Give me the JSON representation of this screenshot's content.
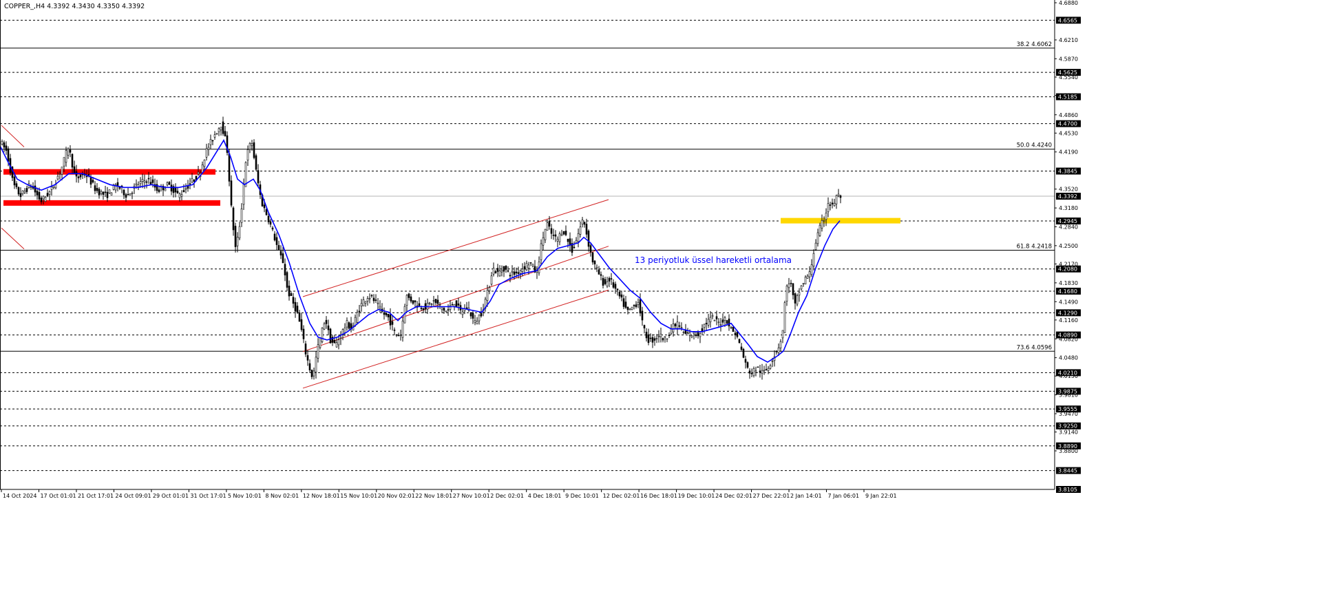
{
  "header": {
    "symbol": "COPPER_,H4",
    "ohlc": "4.3392 4.3430 4.3350 4.3392"
  },
  "annotation": {
    "ema_label": "13 periyotluk üssel hareketli ortalama"
  },
  "chart_data": {
    "type": "candlestick",
    "symbol": "COPPER_",
    "timeframe": "H4",
    "ylim": [
      3.8105,
      4.688
    ],
    "price_ticks": [
      "4.6880",
      "4.6210",
      "4.5870",
      "4.5540",
      "4.5210",
      "4.4860",
      "4.4530",
      "4.4190",
      "4.3520",
      "4.3180",
      "4.2840",
      "4.2500",
      "4.2170",
      "4.1830",
      "4.1490",
      "4.1160",
      "4.0820",
      "4.0480",
      "4.0150",
      "3.9810",
      "3.9470",
      "3.9140",
      "3.8800"
    ],
    "horizontal_levels": [
      4.6565,
      4.5625,
      4.5185,
      4.47,
      4.3845,
      4.2945,
      4.208,
      4.168,
      4.129,
      4.089,
      4.021,
      3.9875,
      3.9555,
      3.925,
      3.889,
      3.8445
    ],
    "level_labels": [
      "4.6565",
      "4.5625",
      "4.5185",
      "4.4700",
      "4.3845",
      "4.2945",
      "4.2080",
      "4.1680",
      "4.1290",
      "4.0890",
      "4.0210",
      "3.9875",
      "3.9555",
      "3.9250",
      "3.8890",
      "3.8445",
      "3.8105"
    ],
    "current_price": {
      "value": 4.3392,
      "label": "4.3392"
    },
    "fibonacci": [
      {
        "label": "38.2 4.6062",
        "value": 4.6062
      },
      {
        "label": "50.0 4.4240",
        "value": 4.424
      },
      {
        "label": "61.8 4.2418",
        "value": 4.2418
      },
      {
        "label": "73.6 4.0596",
        "value": 4.0596
      }
    ],
    "time_labels": [
      "14 Oct 2024",
      "17 Oct 01:01",
      "21 Oct 17:01",
      "24 Oct 09:01",
      "29 Oct 01:01",
      "31 Oct 17:01",
      "5 Nov 10:01",
      "8 Nov 02:01",
      "12 Nov 18:01",
      "15 Nov 10:01",
      "20 Nov 02:01",
      "22 Nov 18:01",
      "27 Nov 10:01",
      "2 Dec 02:01",
      "4 Dec 18:01",
      "9 Dec 10:01",
      "12 Dec 02:01",
      "16 Dec 18:01",
      "19 Dec 10:01",
      "24 Dec 02:01",
      "27 Dec 22:01",
      "2 Jan 14:01",
      "7 Jan 06:01",
      "9 Jan 22:01"
    ],
    "price_path": [
      [
        0,
        4.44
      ],
      [
        10,
        4.42
      ],
      [
        20,
        4.36
      ],
      [
        30,
        4.34
      ],
      [
        45,
        4.36
      ],
      [
        60,
        4.33
      ],
      [
        75,
        4.35
      ],
      [
        90,
        4.39
      ],
      [
        100,
        4.43
      ],
      [
        110,
        4.37
      ],
      [
        125,
        4.38
      ],
      [
        140,
        4.35
      ],
      [
        155,
        4.34
      ],
      [
        170,
        4.36
      ],
      [
        185,
        4.34
      ],
      [
        200,
        4.36
      ],
      [
        215,
        4.37
      ],
      [
        230,
        4.35
      ],
      [
        245,
        4.36
      ],
      [
        260,
        4.34
      ],
      [
        275,
        4.36
      ],
      [
        290,
        4.38
      ],
      [
        300,
        4.42
      ],
      [
        312,
        4.45
      ],
      [
        322,
        4.47
      ],
      [
        330,
        4.43
      ],
      [
        337,
        4.31
      ],
      [
        343,
        4.24
      ],
      [
        350,
        4.3
      ],
      [
        358,
        4.41
      ],
      [
        366,
        4.44
      ],
      [
        373,
        4.38
      ],
      [
        380,
        4.33
      ],
      [
        390,
        4.3
      ],
      [
        398,
        4.27
      ],
      [
        405,
        4.24
      ],
      [
        412,
        4.22
      ],
      [
        418,
        4.17
      ],
      [
        425,
        4.15
      ],
      [
        432,
        4.13
      ],
      [
        438,
        4.1
      ],
      [
        444,
        4.06
      ],
      [
        450,
        4.03
      ],
      [
        455,
        4.01
      ],
      [
        461,
        4.06
      ],
      [
        467,
        4.09
      ],
      [
        473,
        4.12
      ],
      [
        480,
        4.08
      ],
      [
        488,
        4.07
      ],
      [
        496,
        4.09
      ],
      [
        504,
        4.11
      ],
      [
        512,
        4.1
      ],
      [
        520,
        4.13
      ],
      [
        528,
        4.15
      ],
      [
        536,
        4.16
      ],
      [
        545,
        4.15
      ],
      [
        555,
        4.13
      ],
      [
        565,
        4.12
      ],
      [
        575,
        4.09
      ],
      [
        583,
        4.09
      ],
      [
        590,
        4.16
      ],
      [
        600,
        4.15
      ],
      [
        610,
        4.14
      ],
      [
        620,
        4.14
      ],
      [
        630,
        4.15
      ],
      [
        640,
        4.14
      ],
      [
        650,
        4.13
      ],
      [
        660,
        4.15
      ],
      [
        670,
        4.13
      ],
      [
        680,
        4.14
      ],
      [
        690,
        4.11
      ],
      [
        700,
        4.13
      ],
      [
        710,
        4.17
      ],
      [
        716,
        4.21
      ],
      [
        724,
        4.2
      ],
      [
        732,
        4.21
      ],
      [
        740,
        4.2
      ],
      [
        750,
        4.2
      ],
      [
        760,
        4.21
      ],
      [
        770,
        4.22
      ],
      [
        780,
        4.2
      ],
      [
        788,
        4.26
      ],
      [
        795,
        4.29
      ],
      [
        802,
        4.27
      ],
      [
        810,
        4.26
      ],
      [
        818,
        4.28
      ],
      [
        825,
        4.26
      ],
      [
        832,
        4.24
      ],
      [
        840,
        4.27
      ],
      [
        848,
        4.3
      ],
      [
        856,
        4.25
      ],
      [
        862,
        4.22
      ],
      [
        870,
        4.2
      ],
      [
        878,
        4.18
      ],
      [
        886,
        4.19
      ],
      [
        895,
        4.17
      ],
      [
        904,
        4.15
      ],
      [
        912,
        4.13
      ],
      [
        920,
        4.14
      ],
      [
        928,
        4.15
      ],
      [
        935,
        4.1
      ],
      [
        942,
        4.08
      ],
      [
        950,
        4.08
      ],
      [
        958,
        4.09
      ],
      [
        966,
        4.08
      ],
      [
        975,
        4.1
      ],
      [
        985,
        4.11
      ],
      [
        995,
        4.09
      ],
      [
        1005,
        4.09
      ],
      [
        1015,
        4.09
      ],
      [
        1025,
        4.11
      ],
      [
        1035,
        4.12
      ],
      [
        1045,
        4.11
      ],
      [
        1055,
        4.12
      ],
      [
        1062,
        4.1
      ],
      [
        1070,
        4.09
      ],
      [
        1078,
        4.06
      ],
      [
        1085,
        4.03
      ],
      [
        1092,
        4.02
      ],
      [
        1100,
        4.03
      ],
      [
        1108,
        4.02
      ],
      [
        1116,
        4.03
      ],
      [
        1124,
        4.05
      ],
      [
        1132,
        4.07
      ],
      [
        1137,
        4.09
      ],
      [
        1142,
        4.17
      ],
      [
        1148,
        4.19
      ],
      [
        1155,
        4.14
      ],
      [
        1162,
        4.17
      ],
      [
        1170,
        4.19
      ],
      [
        1177,
        4.2
      ],
      [
        1184,
        4.25
      ],
      [
        1191,
        4.28
      ],
      [
        1198,
        4.3
      ],
      [
        1204,
        4.33
      ],
      [
        1210,
        4.32
      ],
      [
        1216,
        4.34
      ],
      [
        1220,
        4.339
      ]
    ],
    "ema_period": 13,
    "ema_path": [
      [
        0,
        4.43
      ],
      [
        12,
        4.4
      ],
      [
        25,
        4.37
      ],
      [
        40,
        4.36
      ],
      [
        60,
        4.35
      ],
      [
        80,
        4.36
      ],
      [
        100,
        4.38
      ],
      [
        120,
        4.38
      ],
      [
        140,
        4.37
      ],
      [
        160,
        4.36
      ],
      [
        180,
        4.355
      ],
      [
        200,
        4.355
      ],
      [
        220,
        4.36
      ],
      [
        240,
        4.355
      ],
      [
        260,
        4.355
      ],
      [
        280,
        4.36
      ],
      [
        300,
        4.39
      ],
      [
        315,
        4.42
      ],
      [
        325,
        4.44
      ],
      [
        335,
        4.41
      ],
      [
        345,
        4.37
      ],
      [
        355,
        4.36
      ],
      [
        368,
        4.37
      ],
      [
        378,
        4.35
      ],
      [
        390,
        4.31
      ],
      [
        405,
        4.27
      ],
      [
        420,
        4.22
      ],
      [
        435,
        4.16
      ],
      [
        450,
        4.11
      ],
      [
        462,
        4.085
      ],
      [
        475,
        4.08
      ],
      [
        490,
        4.085
      ],
      [
        505,
        4.095
      ],
      [
        520,
        4.11
      ],
      [
        535,
        4.125
      ],
      [
        550,
        4.135
      ],
      [
        565,
        4.13
      ],
      [
        578,
        4.115
      ],
      [
        590,
        4.13
      ],
      [
        605,
        4.14
      ],
      [
        620,
        4.14
      ],
      [
        640,
        4.14
      ],
      [
        660,
        4.14
      ],
      [
        680,
        4.135
      ],
      [
        700,
        4.13
      ],
      [
        712,
        4.15
      ],
      [
        725,
        4.18
      ],
      [
        740,
        4.19
      ],
      [
        760,
        4.2
      ],
      [
        780,
        4.205
      ],
      [
        795,
        4.23
      ],
      [
        810,
        4.245
      ],
      [
        825,
        4.25
      ],
      [
        840,
        4.255
      ],
      [
        848,
        4.265
      ],
      [
        858,
        4.255
      ],
      [
        870,
        4.235
      ],
      [
        885,
        4.21
      ],
      [
        900,
        4.19
      ],
      [
        915,
        4.17
      ],
      [
        930,
        4.155
      ],
      [
        945,
        4.13
      ],
      [
        960,
        4.11
      ],
      [
        975,
        4.1
      ],
      [
        990,
        4.1
      ],
      [
        1005,
        4.095
      ],
      [
        1020,
        4.095
      ],
      [
        1035,
        4.1
      ],
      [
        1050,
        4.105
      ],
      [
        1062,
        4.11
      ],
      [
        1075,
        4.09
      ],
      [
        1088,
        4.07
      ],
      [
        1100,
        4.05
      ],
      [
        1115,
        4.04
      ],
      [
        1128,
        4.05
      ],
      [
        1138,
        4.06
      ],
      [
        1148,
        4.09
      ],
      [
        1160,
        4.13
      ],
      [
        1172,
        4.16
      ],
      [
        1185,
        4.21
      ],
      [
        1198,
        4.25
      ],
      [
        1210,
        4.28
      ],
      [
        1220,
        4.295
      ]
    ],
    "zones": [
      {
        "color": "#ff0000",
        "x0": 5,
        "x1": 313,
        "price_top": 4.388,
        "price_bottom": 4.38
      },
      {
        "color": "#ff0000",
        "x0": 5,
        "x1": 320,
        "price_top": 4.332,
        "price_bottom": 4.322
      },
      {
        "color": "#ffd700",
        "x0": 1134,
        "x1": 1308,
        "price_top": 4.3,
        "price_bottom": 4.291
      }
    ],
    "channel": {
      "color": "#d12020",
      "upper": [
        [
          440,
          4.158
        ],
        [
          884,
          4.333
        ]
      ],
      "middle": [
        [
          440,
          4.059
        ],
        [
          884,
          4.249
        ]
      ],
      "lower": [
        [
          440,
          3.993
        ],
        [
          884,
          4.17
        ]
      ]
    },
    "diagonals": [
      [
        [
          2,
          4.467
        ],
        [
          35,
          4.428
        ]
      ],
      [
        [
          2,
          4.282
        ],
        [
          35,
          4.244
        ]
      ]
    ],
    "colors": {
      "candles": "#000000",
      "ema": "#0000ff",
      "level": "#000000",
      "price_tag": "#000000",
      "annotation": "#0000ff"
    }
  }
}
